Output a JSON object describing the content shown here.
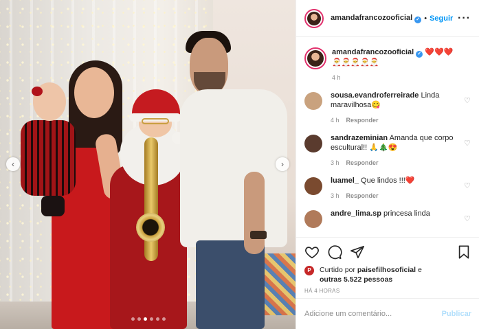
{
  "post": {
    "username": "amandafrancozooficial",
    "separator": "•",
    "follow_label": "Seguir",
    "more_label": "···",
    "carousel": {
      "prev": "‹",
      "next": "›",
      "dots": 6,
      "active_dot": 2
    }
  },
  "caption": {
    "username": "amandafrancozooficial",
    "text_line1": "❤️❤️❤️",
    "text_line2": "🎅🎅🎅🎅🎅",
    "time": "4 h"
  },
  "comments": [
    {
      "username": "sousa.evandroferreirade",
      "text": "Linda maravilhosa😋",
      "time": "4 h",
      "reply": "Responder",
      "avatar_color": "#c9a27e"
    },
    {
      "username": "sandrazeminian",
      "text": "Amanda que corpo escultural!! 🙏🎄😍",
      "time": "3 h",
      "reply": "Responder",
      "avatar_color": "#5a3b2e"
    },
    {
      "username": "luamel_",
      "text": "Que lindos !!!❤️",
      "time": "3 h",
      "reply": "Responder",
      "avatar_color": "#7a4a2f"
    },
    {
      "username": "andre_lima.sp",
      "text": "princesa linda",
      "time": "",
      "reply": "",
      "avatar_color": "#b07a5a"
    }
  ],
  "likes": {
    "prefix": "Curtido por",
    "liker": "paisefilhosoficial",
    "middle": "e",
    "others_prefix": "outras",
    "count": "5.522",
    "suffix": "pessoas",
    "avatar_letter": "P"
  },
  "timestamp": "HÁ 4 HORAS",
  "add_comment": {
    "placeholder": "Adicione um comentário...",
    "post_label": "Publicar"
  },
  "colors": {
    "accent": "#0095f6",
    "verified": "#3897f0",
    "heart": "#ed1c24",
    "muted": "#8e8e8e"
  }
}
